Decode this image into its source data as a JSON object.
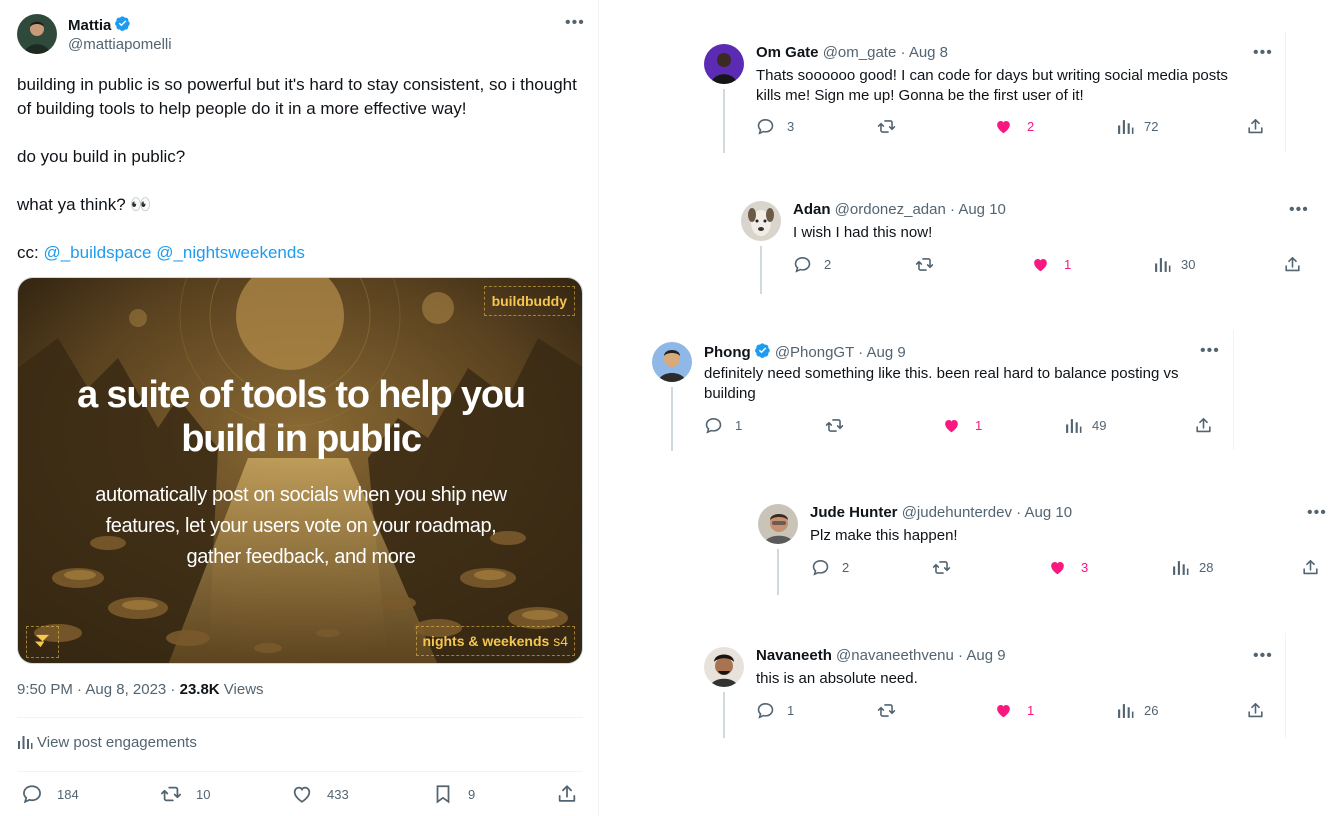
{
  "main_tweet": {
    "author_name": "Mattia",
    "author_handle": "@mattiapomelli",
    "text_lines": [
      "building in public is so powerful but it's hard to stay consistent, so i thought of building tools to help people do it in a more effective way!",
      "",
      "do you build in public?",
      "",
      "what ya think? 👀",
      ""
    ],
    "cc_prefix": "cc: ",
    "mentions": [
      "@_buildspace",
      "@_nightsweekends"
    ],
    "media": {
      "headline_lines": [
        "a suite of tools to help you",
        "build in public"
      ],
      "subline_lines": [
        "automatically post on socials when you ship new",
        "features, let your users vote on your roadmap,",
        "gather feedback, and more"
      ],
      "brand_badge": "buildbuddy",
      "nw_badge": "nights & weekends",
      "nw_season": "s4"
    },
    "time": "9:50 PM · Aug 8, 2023 · ",
    "views_count": "23.8K",
    "views_label": " Views",
    "engagements_label": "View post engagements",
    "stats": {
      "replies": "184",
      "reposts": "10",
      "likes": "433",
      "bookmarks": "9"
    }
  },
  "replies": [
    {
      "name": "Om Gate",
      "handle": "@om_gate",
      "date": " · Aug 8",
      "verified": false,
      "text": "Thats soooooo good! I can code for days but writing social media posts kills me! Sign me up! Gonna be the first user of it!",
      "replies": "3",
      "likes": "2",
      "views": "72"
    },
    {
      "name": "Adan",
      "handle": "@ordonez_adan",
      "date": " · Aug 10",
      "verified": false,
      "text": "I wish I had this now!",
      "replies": "2",
      "likes": "1",
      "views": "30"
    },
    {
      "name": "Phong",
      "handle": "@PhongGT",
      "date": " · Aug 9",
      "verified": true,
      "text": "definitely need something like this. been real hard to balance posting vs building",
      "replies": "1",
      "likes": "1",
      "views": "49"
    },
    {
      "name": "Jude Hunter",
      "handle": "@judehunterdev",
      "date": " · Aug 10",
      "verified": false,
      "text": "Plz make this happen!",
      "replies": "2",
      "likes": "3",
      "views": "28"
    },
    {
      "name": "Navaneeth",
      "handle": "@navaneethvenu",
      "date": " · Aug 9",
      "verified": false,
      "text": "this is an absolute need.",
      "replies": "1",
      "likes": "1",
      "views": "26"
    }
  ],
  "colors": {
    "accent": "#1d9bf0",
    "like": "#f91880",
    "muted": "#536471",
    "badge_gold": "#f5c650"
  }
}
